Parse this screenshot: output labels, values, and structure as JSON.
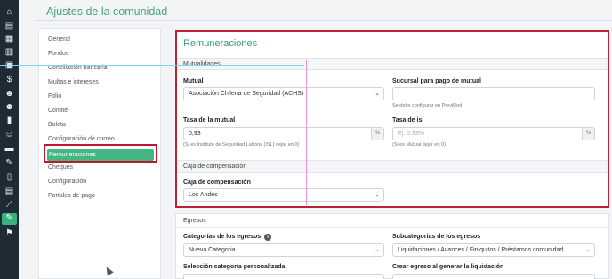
{
  "rail": {
    "icons": [
      "home-icon",
      "document-icon",
      "list-icon",
      "calendar-icon",
      "building-icon",
      "dollar-icon",
      "users-icon",
      "group-icon",
      "briefcase-icon",
      "person-icon",
      "chat-icon",
      "wrench-icon",
      "phone-icon",
      "document-icon",
      "chart-icon",
      "tool-icon",
      "flag-icon"
    ],
    "glyphs": [
      "⌂",
      "▤",
      "▦",
      "▥",
      "▣",
      "$",
      "☻",
      "☻",
      "▮",
      "☺",
      "▬",
      "✎",
      "▯",
      "▤",
      "⟋",
      "✎",
      "⚑"
    ]
  },
  "page_title": "Ajustes de la comunidad",
  "menu": {
    "items": [
      "General",
      "Fondos",
      "Conciliación bancaria",
      "Multas e intereses",
      "Folio",
      "Comité",
      "Boleta",
      "Configuración de correo",
      "Remuneraciones",
      "Cheques",
      "Configuración",
      "Portales de pago"
    ],
    "active": "Remuneraciones"
  },
  "remuneraciones": {
    "title": "Remuneraciones",
    "mutualidades": {
      "section": "Mutualidades",
      "mutual_label": "Mutual",
      "mutual_value": "Asociación Chilena de Seguridad (ACHS)",
      "sucursal_label": "Sucursal para pago de mutual",
      "sucursal_value": "",
      "sucursal_hint": "Se debe configurar en PreviRed",
      "tasa_mutual_label": "Tasa de la mutual",
      "tasa_mutual_value": "0,93",
      "tasa_mutual_hint": "(Si es Instituto de Seguridad Laboral (ISL) dejar en 0)",
      "tasa_isl_label": "Tasa de isl",
      "tasa_isl_placeholder": "Ej: 0.93%",
      "tasa_isl_hint": "(Si es Mutual dejar en 0)",
      "percent": "%"
    },
    "caja": {
      "section": "Caja de compensación",
      "label": "Caja de compensación",
      "value": "Los Andes"
    }
  },
  "egresos": {
    "section": "Egresos",
    "categorias_label": "Categorías de los egresos",
    "categorias_value": "Nueva Categoria",
    "subcategorias_label": "Subcategorías de los egresos",
    "subcategorias_value": "Liquidaciones / Avances / Finiquitos / Préstamos comunidad",
    "seleccion_label": "Selección categoría personalizada",
    "crear_label": "Crear egreso al generar la liquidación"
  },
  "chevron": "⌄",
  "info": "i"
}
